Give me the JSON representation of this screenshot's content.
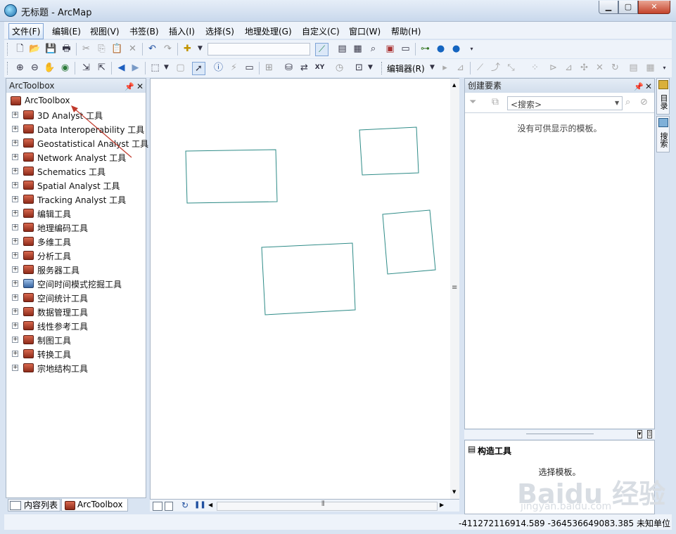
{
  "window": {
    "title": "无标题 - ArcMap",
    "min": "▁",
    "max": "▢",
    "close": "✕"
  },
  "menu": [
    "文件(F)",
    "编辑(E)",
    "视图(V)",
    "书签(B)",
    "插入(I)",
    "选择(S)",
    "地理处理(G)",
    "自定义(C)",
    "窗口(W)",
    "帮助(H)"
  ],
  "toolbar": {
    "editor_label": "编辑器(R)",
    "scale_value": ""
  },
  "toc": {
    "title": "ArcToolbox",
    "root": "ArcToolbox",
    "items": [
      "3D Analyst 工具",
      "Data Interoperability 工具",
      "Geostatistical Analyst 工具",
      "Network Analyst 工具",
      "Schematics 工具",
      "Spatial Analyst 工具",
      "Tracking Analyst 工具",
      "编辑工具",
      "地理编码工具",
      "多维工具",
      "分析工具",
      "服务器工具",
      "空间时间模式挖掘工具",
      "空间统计工具",
      "数据管理工具",
      "线性参考工具",
      "制图工具",
      "转换工具",
      "宗地结构工具"
    ],
    "tabs": [
      "内容列表",
      "ArcToolbox"
    ]
  },
  "create_features": {
    "title": "创建要素",
    "search_placeholder": "<搜索>",
    "empty_msg": "没有可供显示的模板。"
  },
  "construct_tools": {
    "title": "构造工具",
    "msg": "选择模板。"
  },
  "side_tabs": [
    "目录",
    "搜索"
  ],
  "status": {
    "coords": "-411272116914.589  -364536649083.385 未知单位"
  },
  "watermark": {
    "main": "Baidu 经验",
    "sub": "jingyan.baidu.com"
  },
  "colors": {
    "polygon_stroke": "#2e8b87",
    "arrow": "#c0392b"
  }
}
